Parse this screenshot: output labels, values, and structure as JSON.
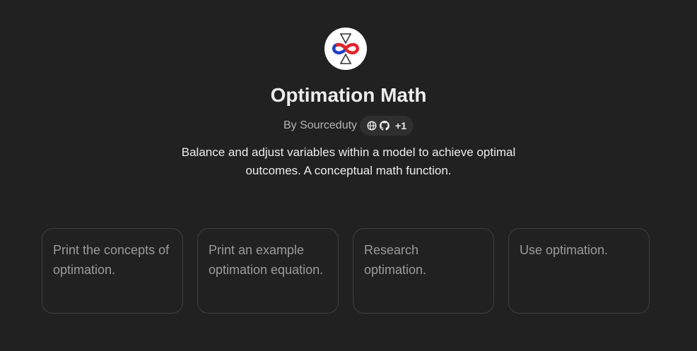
{
  "gpt": {
    "name": "Optimation Math",
    "author": "By Sourceduty",
    "links": {
      "icons": [
        "globe-icon",
        "github-icon"
      ],
      "more_count": "+1"
    },
    "description": "Balance and adjust variables within a model to achieve optimal outcomes. A conceptual math function."
  },
  "conversation_starters": [
    {
      "text": "Print the concepts of optimation."
    },
    {
      "text": "Print an example optimation equation."
    },
    {
      "text": "Research optimation."
    },
    {
      "text": "Use optimation."
    }
  ],
  "colors": {
    "background": "#212121",
    "logo_red": "#e0262b",
    "logo_blue": "#1f3fc4"
  }
}
